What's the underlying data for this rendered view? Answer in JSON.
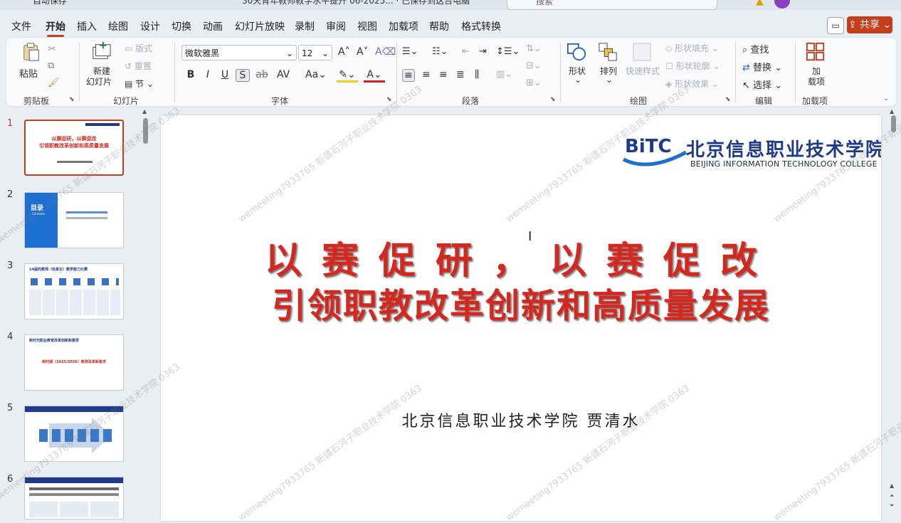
{
  "window": {
    "autosave_label": "自动保存",
    "doc_title": "30天青年教师教学水平提升 06-2025... · 已保存到这台电脑",
    "search_placeholder": "搜索"
  },
  "tabs": [
    "文件",
    "开始",
    "插入",
    "绘图",
    "设计",
    "切换",
    "动画",
    "幻灯片放映",
    "录制",
    "审阅",
    "视图",
    "加载项",
    "帮助",
    "格式转换"
  ],
  "active_tab": "开始",
  "share_label": "共享",
  "ribbon": {
    "clipboard": {
      "paste": "粘贴",
      "label": "剪贴板"
    },
    "slides": {
      "new_slide": "新建",
      "new_slide2": "幻灯片",
      "layout": "版式",
      "reset": "重置",
      "section": "节",
      "label": "幻灯片"
    },
    "font": {
      "family": "微软雅黑",
      "size": "12",
      "label": "字体"
    },
    "paragraph": {
      "label": "段落"
    },
    "drawing": {
      "shapes": "形状",
      "arrange": "排列",
      "quick_styles": "快速样式",
      "shape_fill": "形状填充",
      "shape_outline": "形状轮廓",
      "shape_effects": "形状效果",
      "label": "绘图"
    },
    "editing": {
      "find": "查找",
      "replace": "替换",
      "select": "选择",
      "label": "编辑"
    },
    "addins": {
      "addins_line1": "加",
      "addins_line2": "载项",
      "label": "加载项"
    }
  },
  "thumbnails": [
    {
      "num": "1",
      "title": "以赛促研，以赛促改",
      "sub": "引领职教改革创新和高质量发展"
    },
    {
      "num": "2",
      "title": "目录",
      "sub": "Contents"
    },
    {
      "num": "3",
      "title": "14届的教师（信息化）教学能力比赛"
    },
    {
      "num": "4",
      "title": "新时代职业教育改革创新新要求",
      "sub": "新时期（2025/2026）教育改革新要求"
    },
    {
      "num": "5"
    },
    {
      "num": "6"
    }
  ],
  "slide": {
    "logo_mark": "BiTC",
    "logo_cn": "北京信息职业技术学院",
    "logo_en": "BEIJING INFORMATION TECHNOLOGY COLLEGE",
    "title_line1": "以赛促研，以赛促改",
    "title_line2": "引领职教改革创新和高质量发展",
    "presenter": "北京信息职业技术学院 贾清水"
  },
  "watermark": "wemeeting7933765 新疆石河子职业技术学院 0363",
  "colors": {
    "accent": "#c43e1c",
    "title_red": "#d6271f",
    "logo_blue": "#1f3a8a"
  }
}
